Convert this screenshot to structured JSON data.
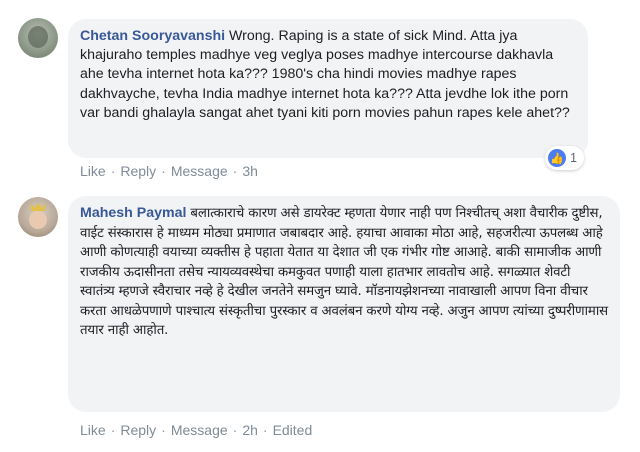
{
  "comments": [
    {
      "author": "Chetan Sooryavanshi",
      "text": "Wrong. Raping is a state of sick Mind. Atta jya khajuraho temples madhye veg veglya poses madhye intercourse dakhavla ahe tevha internet hota ka??? 1980's cha hindi movies madhye rapes dakhvayche, tevha India madhye internet hota ka??? Atta jevdhe lok ithe porn var bandi ghalayla sangat ahet tyani kiti porn movies pahun rapes kele ahet??",
      "reaction_count": "1",
      "like_label": "Like",
      "reply_label": "Reply",
      "message_label": "Message",
      "time": "3h"
    },
    {
      "author": "Mahesh Paymal",
      "text": "बलात्काराचे कारण असे डायरेक्ट म्हणता येणार नाही पण निश्चीतच् अशा वैचारीक दुष्टीस, वाईट संस्कारास हे माध्यम मोठ्या प्रमाणात जबाबदार आहे. हयाचा आवाका मोठा आहे, सहजरीत्या ऊपलब्ध आहे आणी कोणत्याही वयाच्या व्यक्तीस हे पहाता येतात या देशात जी एक गंभीर गोष्ट आआहे. बाकी सामाजीक आणी राजकीय ऊदासीनता तसेच न्यायव्यवस्थेचा कमकुवत पणाही याला हातभार लावतोच आहे. सगळ्यात शेवटी स्वातंत्र्य म्हणजे स्वैराचार नव्हे हे देखील जनतेने समजुन घ्यावे. मॉडनायझेशनच्या नावाखाली आपण विना वीचार करता आधळेपणाणे पाश्चात्य संस्कृतीचा पुरस्कार व अवलंबन करणे योग्य नव्हे. अजुन आपण त्यांच्या दुष्परीणामास तयार नाही आहोत.",
      "like_label": "Like",
      "reply_label": "Reply",
      "message_label": "Message",
      "time": "2h",
      "edited_label": "Edited"
    }
  ],
  "separator": "·",
  "colors": {
    "author": "#385898",
    "bubble": "#f2f3f5",
    "action": "#7f8b96",
    "like_icon": "#4a7cf2"
  },
  "icons": {
    "reaction": "thumbs-up-icon"
  }
}
